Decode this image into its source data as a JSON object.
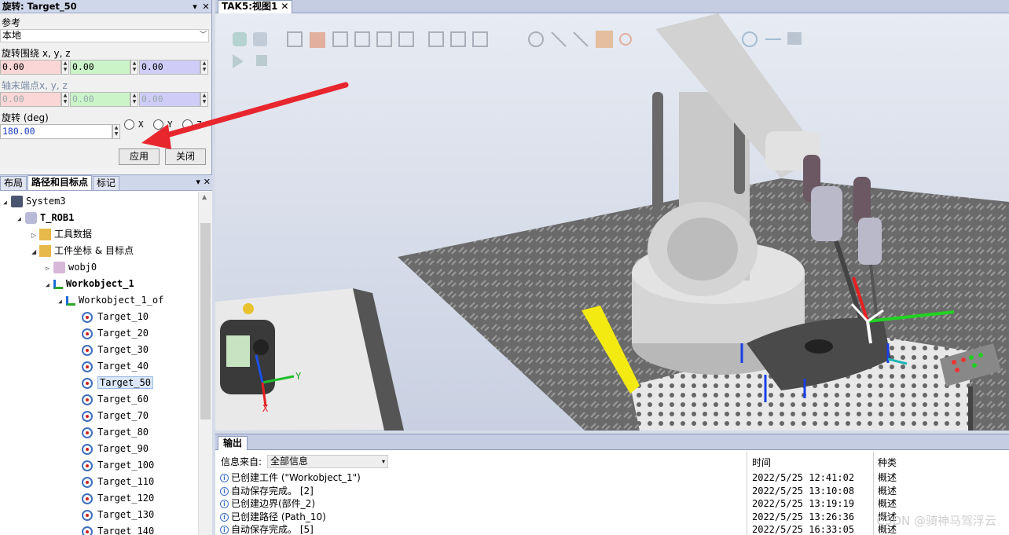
{
  "rotate_panel": {
    "title": "旋转: Target_50",
    "pin": "▾",
    "close": "✕",
    "reference_label": "参考",
    "reference_value": "本地",
    "rotate_around_label": "旋转围绕 x, y, z",
    "rotate_around": [
      "0.00",
      "0.00",
      "0.00"
    ],
    "axis_end_label": "轴末端点x, y, z",
    "axis_end": [
      "0.00",
      "0.00",
      "0.00"
    ],
    "rotation_label": "旋转 (deg)",
    "rotation_value": "180.00",
    "axis_options": [
      "X",
      "Y",
      "Z"
    ],
    "apply_label": "应用",
    "close_label": "关闭"
  },
  "tree_panel": {
    "tabs": [
      "布局",
      "路径和目标点",
      "标记"
    ],
    "tools": "▾ ✕",
    "nodes": {
      "system": "System3",
      "rob": "T_ROB1",
      "tooldata": "工具数据",
      "wobj_targets": "工件坐标 & 目标点",
      "wobj0": "wobj0",
      "workobject": "Workobject_1",
      "workobject_of": "Workobject_1_of"
    },
    "targets": [
      "Target_10",
      "Target_20",
      "Target_30",
      "Target_40",
      "Target_50",
      "Target_60",
      "Target_70",
      "Target_80",
      "Target_90",
      "Target_100",
      "Target_110",
      "Target_120",
      "Target_130",
      "Target_140"
    ],
    "selected_target": "Target_50"
  },
  "viewport": {
    "tab_label": "TAK5:视图1",
    "tab_close": "✕",
    "axis_x": "X",
    "axis_y": "Y"
  },
  "output": {
    "tab_label": "输出",
    "filter_label": "信息来自:",
    "filter_value": "全部信息",
    "col_time": "时间",
    "col_type": "种类",
    "rows": [
      {
        "msg": "已创建工件 (\"Workobject_1\")",
        "time": "2022/5/25 12:41:02",
        "type": "概述"
      },
      {
        "msg": "自动保存完成。 [2]",
        "time": "2022/5/25 13:10:08",
        "type": "概述"
      },
      {
        "msg": "已创建边界(部件_2)",
        "time": "2022/5/25 13:19:19",
        "type": "概述"
      },
      {
        "msg": "已创建路径 (Path_10)",
        "time": "2022/5/25 13:26:36",
        "type": "概述"
      },
      {
        "msg": "自动保存完成。 [5]",
        "time": "2022/5/25 16:33:05",
        "type": "概述"
      }
    ],
    "watermark": "CSDN @骑神马驾浮云"
  },
  "colors": {
    "annotation_arrow": "#e8262e",
    "panel_header": "#cfd8ea",
    "selection": "#dbe7f7"
  }
}
